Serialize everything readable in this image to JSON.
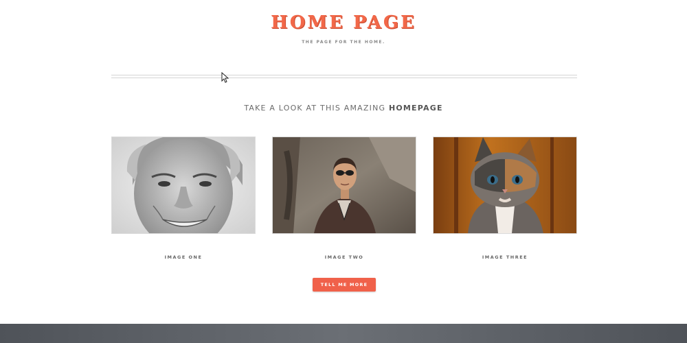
{
  "header": {
    "title": "HOME PAGE",
    "subtitle": "THE PAGE FOR THE HOME."
  },
  "section": {
    "heading_prefix": "TAKE A LOOK AT THIS AMAZING",
    "heading_emphasis": "HOMEPAGE"
  },
  "gallery": {
    "items": [
      {
        "caption": "IMAGE ONE",
        "subject": "grayscale-portrait-older-man"
      },
      {
        "caption": "IMAGE TWO",
        "subject": "man-with-sunglasses-brown-jacket"
      },
      {
        "caption": "IMAGE THREE",
        "subject": "calico-kitten"
      }
    ]
  },
  "cta": {
    "label": "TELL ME MORE"
  },
  "colors": {
    "accent": "#f26849",
    "button": "#f0614a",
    "footer": "#5d6167",
    "text_muted": "#6a6a6a"
  }
}
